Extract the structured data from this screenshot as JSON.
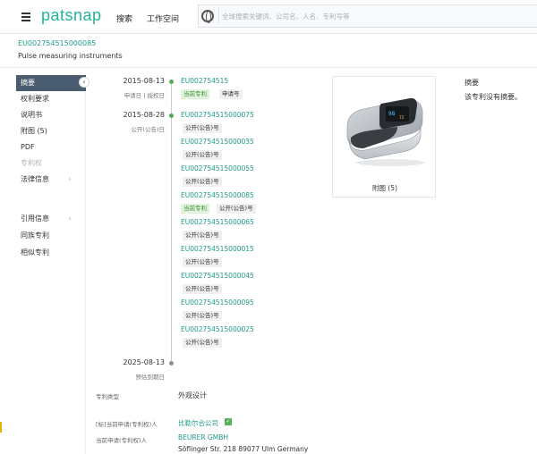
{
  "header": {
    "logo_text": "patsnap",
    "nav_search": "搜索",
    "nav_workspace": "工作空间",
    "search_placeholder": "全球搜索关键词、公司名、人名、专利号等"
  },
  "patent": {
    "number": "EU002754515000085",
    "title": "Pulse measuring instruments"
  },
  "sidebar": {
    "collapse_icon": "‹",
    "items": [
      {
        "label": "摘要",
        "active": true
      },
      {
        "label": "权利要求"
      },
      {
        "label": "说明书"
      },
      {
        "label": "附图 (5)"
      },
      {
        "label": "PDF"
      },
      {
        "label": "专利权",
        "disabled": true
      },
      {
        "label": "法律信息",
        "chevron": "›"
      },
      {
        "label": "引用信息",
        "chevron": "›"
      },
      {
        "label": "同族专利"
      },
      {
        "label": "相似专利"
      }
    ]
  },
  "timeline": {
    "events": [
      {
        "date": "2015-08-13",
        "sub": "申请日 | 授权日"
      },
      {
        "date": "2015-08-28",
        "sub": "公开(公告)日"
      },
      {
        "date": "2025-08-13",
        "sub": "预估到期日"
      }
    ],
    "entries": [
      {
        "number": "EU002754515",
        "tags": [
          {
            "text": "当前专利",
            "green": true
          },
          {
            "text": "申请号"
          }
        ]
      },
      {
        "number": "EU002754515000075",
        "tags": [
          {
            "text": "公开(公告)号"
          }
        ]
      },
      {
        "number": "EU002754515000035",
        "tags": [
          {
            "text": "公开(公告)号"
          }
        ]
      },
      {
        "number": "EU002754515000055",
        "tags": [
          {
            "text": "公开(公告)号"
          }
        ]
      },
      {
        "number": "EU002754515000085",
        "tags": [
          {
            "text": "当前专利",
            "green": true
          },
          {
            "text": "公开(公告)号"
          }
        ]
      },
      {
        "number": "EU002754515000065",
        "tags": [
          {
            "text": "公开(公告)号"
          }
        ]
      },
      {
        "number": "EU002754515000015",
        "tags": [
          {
            "text": "公开(公告)号"
          }
        ]
      },
      {
        "number": "EU002754515000045",
        "tags": [
          {
            "text": "公开(公告)号"
          }
        ]
      },
      {
        "number": "EU002754515000095",
        "tags": [
          {
            "text": "公开(公告)号"
          }
        ]
      },
      {
        "number": "EU002754515000025",
        "tags": [
          {
            "text": "公开(公告)号"
          }
        ]
      }
    ]
  },
  "image_card": {
    "caption": "附图 (5)"
  },
  "abstract": {
    "title": "摘要",
    "text": "该专利没有摘要。"
  },
  "info": {
    "patent_type_label": "专利类型",
    "patent_type_value": "外观设计",
    "original_applicant_label": "[标]当前申请(专利权)人",
    "original_applicant_value": "比勒尔合公司",
    "current_applicant_label": "当前申请(专利权)人",
    "current_applicant_value": "BEURER GMBH",
    "address": "Söflinger Str. 218 89077 Ulm Germany"
  }
}
